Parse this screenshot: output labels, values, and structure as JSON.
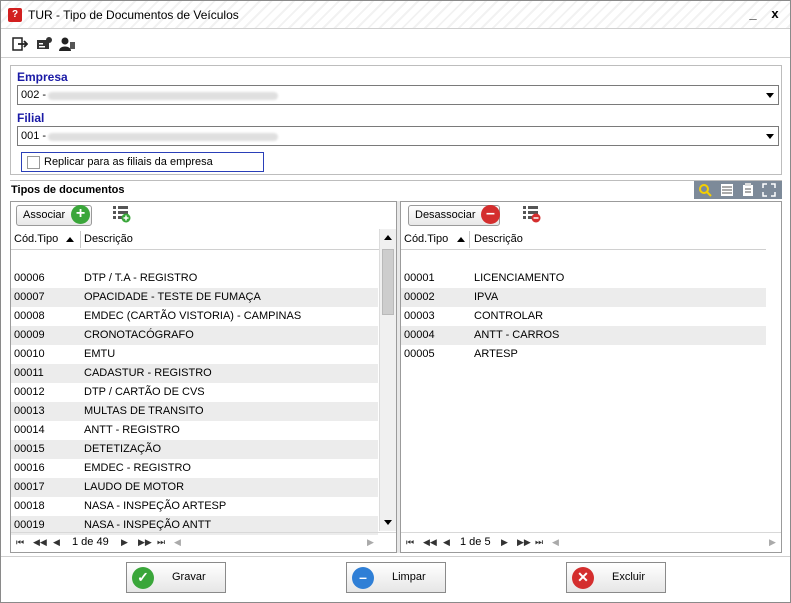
{
  "window": {
    "title": "TUR - Tipo de Documentos de Veículos",
    "minimize": "_",
    "close": "x"
  },
  "toolbar": {
    "icons": [
      "exit-icon",
      "card-icon",
      "user-icon"
    ]
  },
  "filters": {
    "empresa_label": "Empresa",
    "empresa_value": "002 -",
    "filial_label": "Filial",
    "filial_value": "001 -",
    "replicar_label": "Replicar para as filiais da empresa"
  },
  "section": {
    "title": "Tipos de documentos"
  },
  "left": {
    "action_label": "Associar",
    "col_code": "Cód.Tipo",
    "col_desc": "Descrição",
    "rows": [
      {
        "code": "00006",
        "desc": "DTP / T.A - REGISTRO"
      },
      {
        "code": "00007",
        "desc": "OPACIDADE - TESTE DE FUMAÇA"
      },
      {
        "code": "00008",
        "desc": "EMDEC (CARTÃO VISTORIA) - CAMPINAS"
      },
      {
        "code": "00009",
        "desc": "CRONOTACÓGRAFO"
      },
      {
        "code": "00010",
        "desc": "EMTU"
      },
      {
        "code": "00011",
        "desc": "CADASTUR - REGISTRO"
      },
      {
        "code": "00012",
        "desc": "DTP / CARTÃO DE CVS"
      },
      {
        "code": "00013",
        "desc": "MULTAS DE TRANSITO"
      },
      {
        "code": "00014",
        "desc": "ANTT - REGISTRO"
      },
      {
        "code": "00015",
        "desc": "DETETIZAÇÃO"
      },
      {
        "code": "00016",
        "desc": "EMDEC - REGISTRO"
      },
      {
        "code": "00017",
        "desc": "LAUDO DE MOTOR"
      },
      {
        "code": "00018",
        "desc": "NASA - INSPEÇÃO ARTESP"
      },
      {
        "code": "00019",
        "desc": "NASA - INSPEÇÃO ANTT"
      }
    ],
    "pager": "1 de 49"
  },
  "right": {
    "action_label": "Desassociar",
    "col_code": "Cód.Tipo",
    "col_desc": "Descrição",
    "rows": [
      {
        "code": "00001",
        "desc": "LICENCIAMENTO"
      },
      {
        "code": "00002",
        "desc": "IPVA"
      },
      {
        "code": "00003",
        "desc": "CONTROLAR"
      },
      {
        "code": "00004",
        "desc": "ANTT - CARROS"
      },
      {
        "code": "00005",
        "desc": "ARTESP"
      }
    ],
    "pager": "1 de 5"
  },
  "footer": {
    "save": "Gravar",
    "clear": "Limpar",
    "delete": "Excluir"
  },
  "colors": {
    "accent_label": "#1a1aa6",
    "save_green": "#3aa63a",
    "clear_blue": "#2f7fd6",
    "delete_red": "#d42e2e"
  }
}
